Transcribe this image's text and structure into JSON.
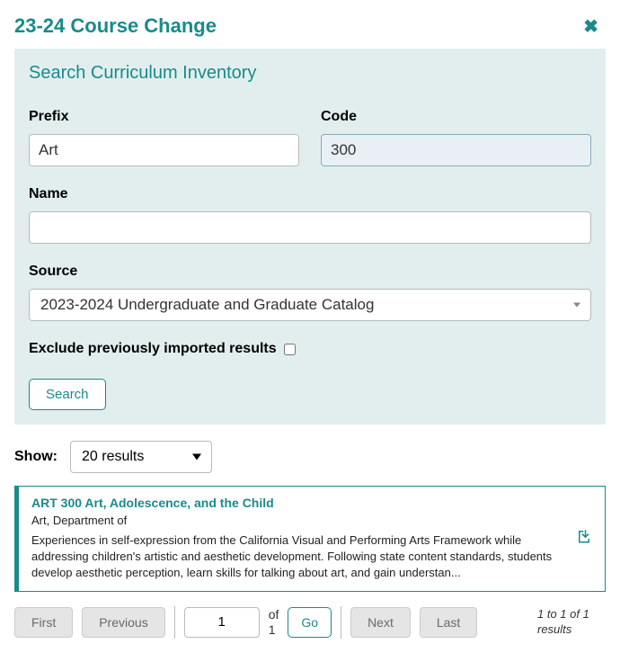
{
  "header": {
    "title": "23-24 Course Change"
  },
  "panel": {
    "title": "Search Curriculum Inventory",
    "prefix_label": "Prefix",
    "prefix_value": "Art",
    "code_label": "Code",
    "code_value": "300",
    "name_label": "Name",
    "name_value": "",
    "source_label": "Source",
    "source_value": "2023-2024 Undergraduate and Graduate Catalog",
    "exclude_label": "Exclude previously imported results",
    "search_label": "Search"
  },
  "show": {
    "label": "Show:",
    "value": "20 results"
  },
  "result": {
    "title": "ART 300 Art, Adolescence, and the Child",
    "dept": "Art, Department of",
    "desc": "Experiences in self-expression from the California Visual and Performing Arts Framework while addressing children's artistic and aesthetic development. Following state content standards, students develop aesthetic perception, learn skills for talking about art, and gain understan..."
  },
  "pager": {
    "first": "First",
    "previous": "Previous",
    "page_value": "1",
    "of_label": "of",
    "total_pages": "1",
    "go": "Go",
    "next": "Next",
    "last": "Last",
    "summary": "1 to 1 of 1 results"
  }
}
